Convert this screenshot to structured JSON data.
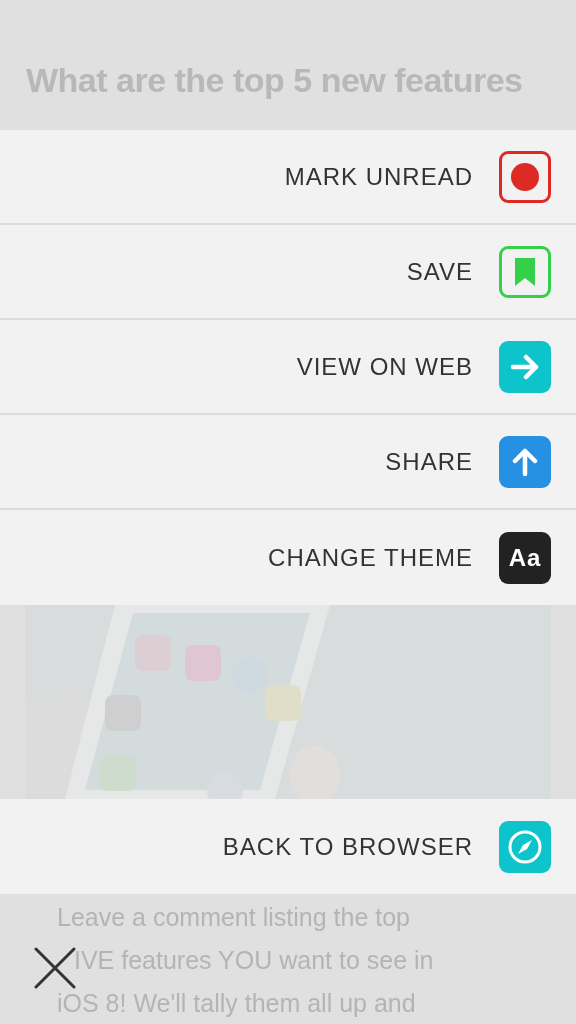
{
  "article": {
    "heading": "What are the top 5 new features",
    "body_lines": [
      "Leave a comment listing the top",
      "IVE features YOU want to see in",
      "iOS 8! We'll tally them all up and"
    ]
  },
  "menu": {
    "items": [
      {
        "label": "MARK UNREAD",
        "kind": "record"
      },
      {
        "label": "SAVE",
        "kind": "bookmark"
      },
      {
        "label": "VIEW ON WEB",
        "kind": "arrow"
      },
      {
        "label": "SHARE",
        "kind": "share"
      },
      {
        "label": "CHANGE THEME",
        "kind": "theme",
        "glyph": "Aa"
      }
    ]
  },
  "back_item": {
    "label": "BACK TO BROWSER",
    "kind": "compass"
  }
}
